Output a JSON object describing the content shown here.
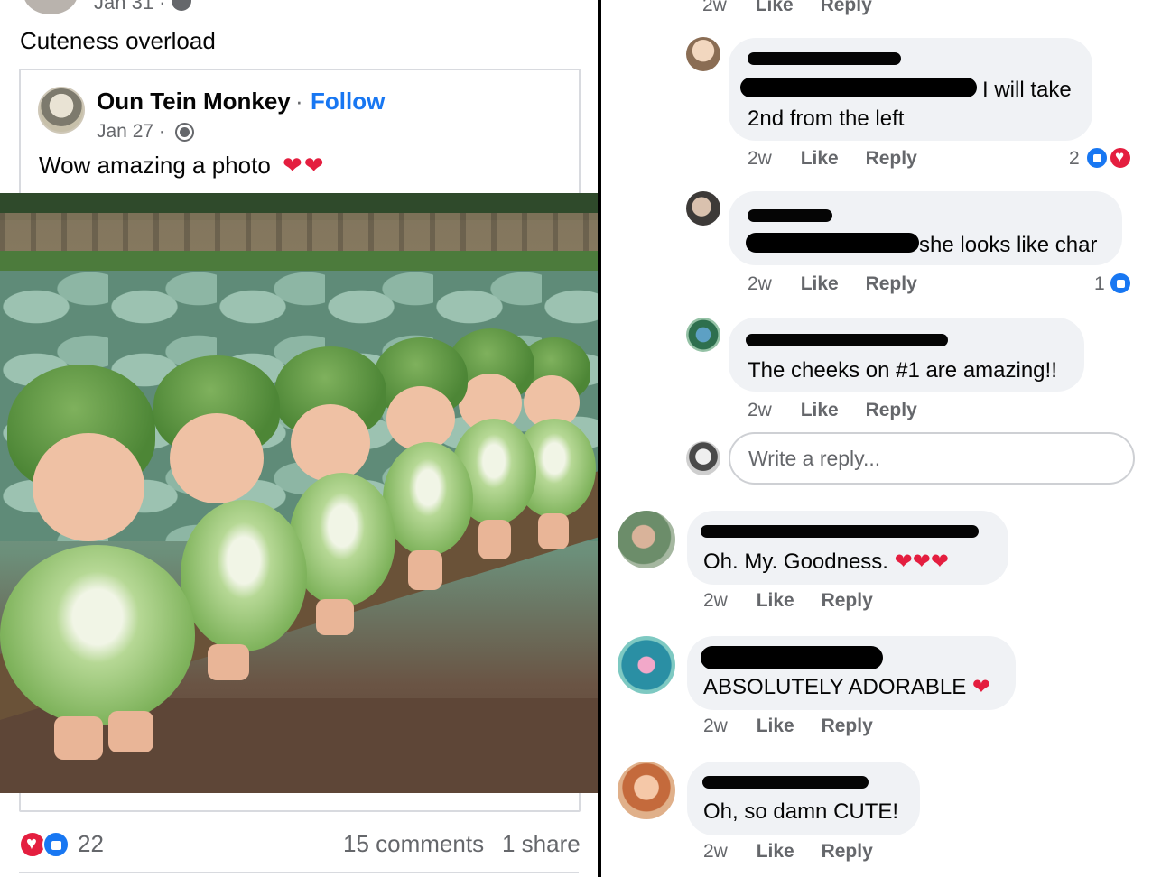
{
  "post": {
    "top_date": "Jan 31 ·",
    "caption": "Cuteness overload",
    "shared": {
      "author": "Oun Tein Monkey",
      "dot": "·",
      "follow_label": "Follow",
      "date": "Jan 27 ·",
      "text": "Wow amazing a photo",
      "hearts": "❤❤"
    },
    "reactions": {
      "count": "22",
      "types": [
        "love-icon",
        "like-icon"
      ]
    },
    "comments_label": "15 comments",
    "shares_label": "1 share"
  },
  "comments": {
    "top_meta": {
      "time": "2w",
      "like": "Like",
      "reply": "Reply"
    },
    "items": [
      {
        "text_line1": "I will take",
        "text_line2": "2nd from the left",
        "time": "2w",
        "like": "Like",
        "reply": "Reply",
        "reaction_count": "2",
        "reaction_types": [
          "like-icon",
          "love-icon"
        ]
      },
      {
        "text": "she looks like char",
        "time": "2w",
        "like": "Like",
        "reply": "Reply",
        "reaction_count": "1",
        "reaction_types": [
          "like-icon"
        ]
      },
      {
        "text": "The cheeks on #1 are amazing!!",
        "time": "2w",
        "like": "Like",
        "reply": "Reply"
      }
    ],
    "reply_placeholder": "Write a reply...",
    "top_level": [
      {
        "text": "Oh. My. Goodness.",
        "emoji": "❤❤❤",
        "time": "2w",
        "like": "Like",
        "reply": "Reply"
      },
      {
        "text": "ABSOLUTELY ADORABLE",
        "emoji": "❤",
        "time": "2w",
        "like": "Like",
        "reply": "Reply"
      },
      {
        "text": "Oh, so damn CUTE!",
        "time": "2w",
        "like": "Like",
        "reply": "Reply"
      }
    ]
  },
  "colors": {
    "link_blue": "#1877f2",
    "love_red": "#e41e3f",
    "bubble": "#f0f2f5",
    "meta_gray": "#65676b"
  }
}
